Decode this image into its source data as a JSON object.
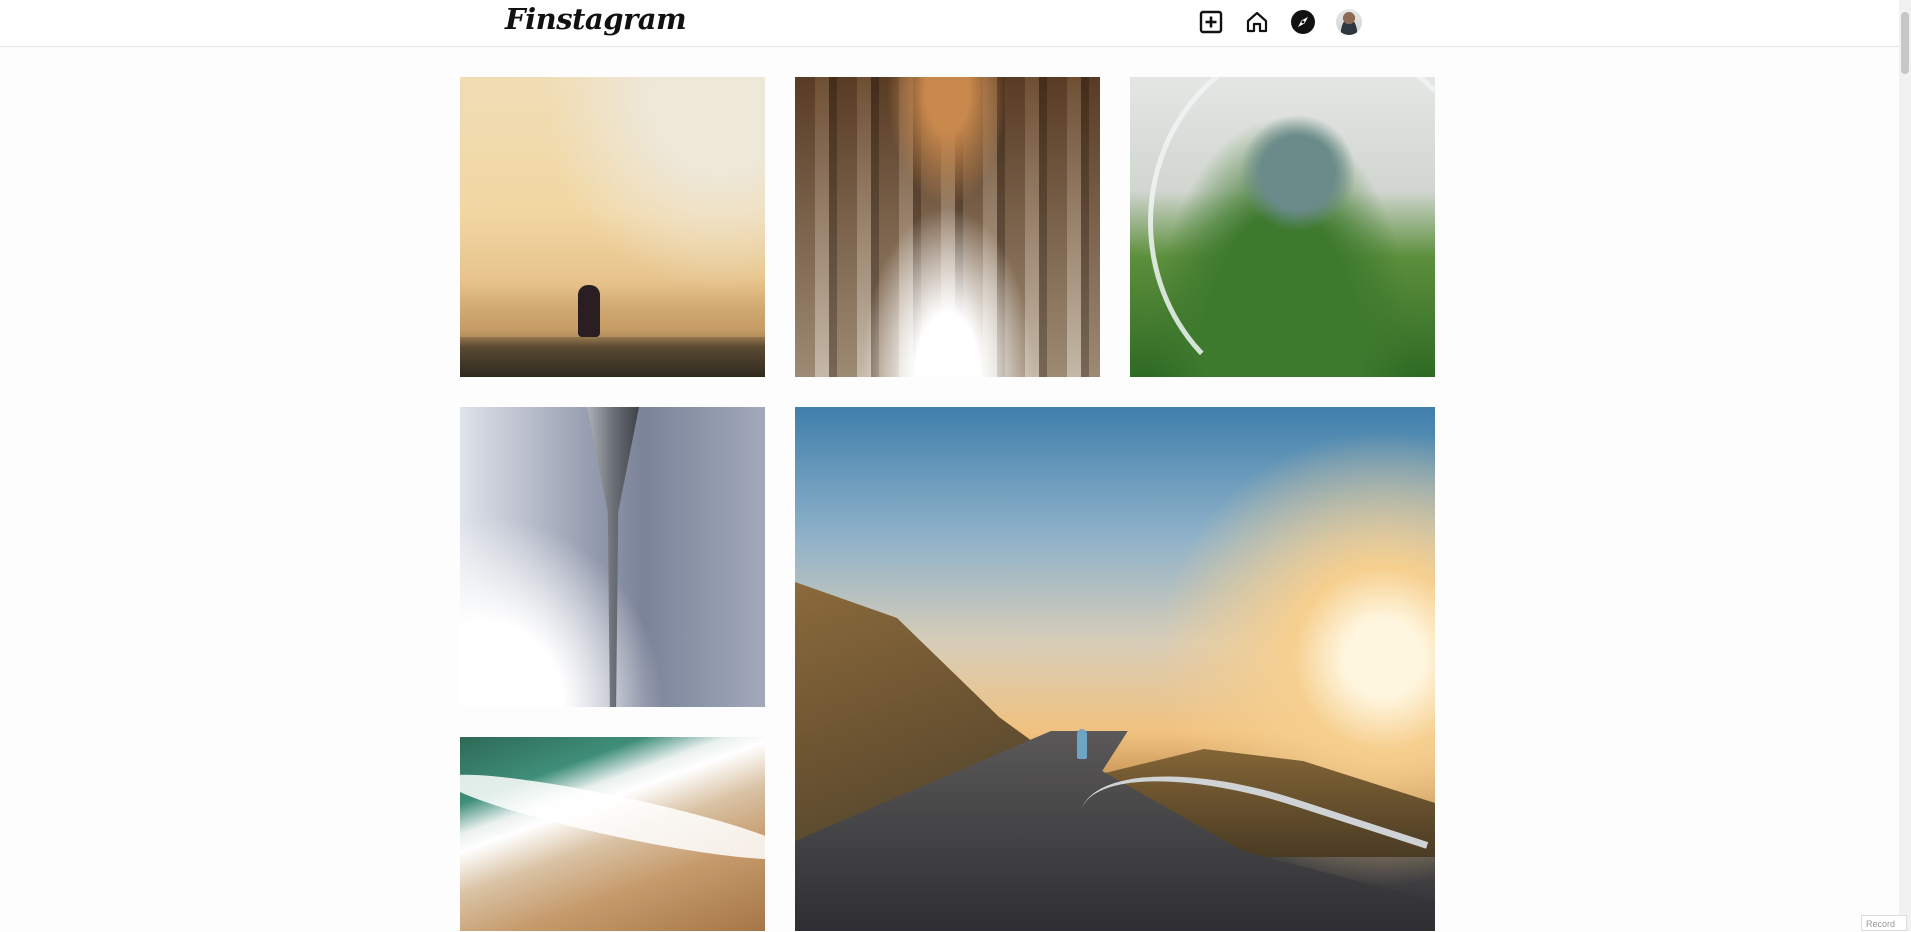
{
  "header": {
    "logo_text": "Finstagram",
    "nav": [
      {
        "name": "new-post",
        "icon": "plus-square-icon"
      },
      {
        "name": "home",
        "icon": "home-icon"
      },
      {
        "name": "explore",
        "icon": "compass-icon"
      },
      {
        "name": "profile",
        "icon": "avatar"
      }
    ]
  },
  "feed": {
    "images": [
      {
        "id": "runner-city",
        "description_icon": "photo"
      },
      {
        "id": "cathedral-arches",
        "description_icon": "photo"
      },
      {
        "id": "succulent-terrarium",
        "description_icon": "photo"
      },
      {
        "id": "spire-sky",
        "description_icon": "photo"
      },
      {
        "id": "coastal-road-runner",
        "description_icon": "photo"
      },
      {
        "id": "ocean-waves-beach",
        "description_icon": "photo"
      }
    ]
  },
  "corner_widget": {
    "label": "Record"
  },
  "colors": {
    "background": "#fdfdfd",
    "header_border": "#e6e6e6",
    "icon": "#111111"
  }
}
